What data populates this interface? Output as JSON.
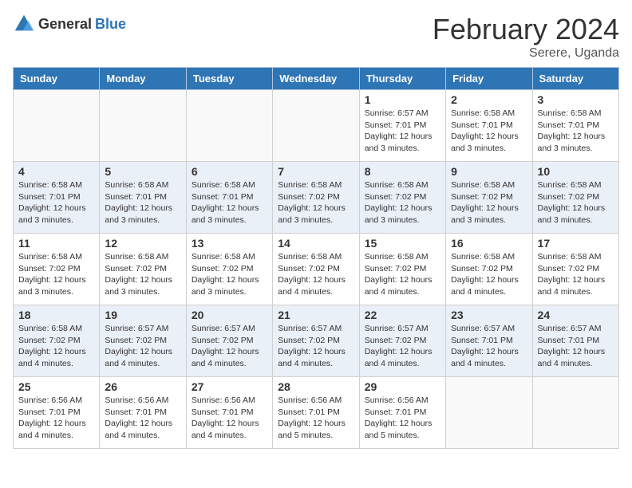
{
  "header": {
    "logo_general": "General",
    "logo_blue": "Blue",
    "month": "February 2024",
    "location": "Serere, Uganda"
  },
  "weekdays": [
    "Sunday",
    "Monday",
    "Tuesday",
    "Wednesday",
    "Thursday",
    "Friday",
    "Saturday"
  ],
  "weeks": [
    {
      "alt": false,
      "days": [
        {
          "num": "",
          "detail": ""
        },
        {
          "num": "",
          "detail": ""
        },
        {
          "num": "",
          "detail": ""
        },
        {
          "num": "",
          "detail": ""
        },
        {
          "num": "1",
          "detail": "Sunrise: 6:57 AM\nSunset: 7:01 PM\nDaylight: 12 hours\nand 3 minutes."
        },
        {
          "num": "2",
          "detail": "Sunrise: 6:58 AM\nSunset: 7:01 PM\nDaylight: 12 hours\nand 3 minutes."
        },
        {
          "num": "3",
          "detail": "Sunrise: 6:58 AM\nSunset: 7:01 PM\nDaylight: 12 hours\nand 3 minutes."
        }
      ]
    },
    {
      "alt": true,
      "days": [
        {
          "num": "4",
          "detail": "Sunrise: 6:58 AM\nSunset: 7:01 PM\nDaylight: 12 hours\nand 3 minutes."
        },
        {
          "num": "5",
          "detail": "Sunrise: 6:58 AM\nSunset: 7:01 PM\nDaylight: 12 hours\nand 3 minutes."
        },
        {
          "num": "6",
          "detail": "Sunrise: 6:58 AM\nSunset: 7:01 PM\nDaylight: 12 hours\nand 3 minutes."
        },
        {
          "num": "7",
          "detail": "Sunrise: 6:58 AM\nSunset: 7:02 PM\nDaylight: 12 hours\nand 3 minutes."
        },
        {
          "num": "8",
          "detail": "Sunrise: 6:58 AM\nSunset: 7:02 PM\nDaylight: 12 hours\nand 3 minutes."
        },
        {
          "num": "9",
          "detail": "Sunrise: 6:58 AM\nSunset: 7:02 PM\nDaylight: 12 hours\nand 3 minutes."
        },
        {
          "num": "10",
          "detail": "Sunrise: 6:58 AM\nSunset: 7:02 PM\nDaylight: 12 hours\nand 3 minutes."
        }
      ]
    },
    {
      "alt": false,
      "days": [
        {
          "num": "11",
          "detail": "Sunrise: 6:58 AM\nSunset: 7:02 PM\nDaylight: 12 hours\nand 3 minutes."
        },
        {
          "num": "12",
          "detail": "Sunrise: 6:58 AM\nSunset: 7:02 PM\nDaylight: 12 hours\nand 3 minutes."
        },
        {
          "num": "13",
          "detail": "Sunrise: 6:58 AM\nSunset: 7:02 PM\nDaylight: 12 hours\nand 3 minutes."
        },
        {
          "num": "14",
          "detail": "Sunrise: 6:58 AM\nSunset: 7:02 PM\nDaylight: 12 hours\nand 4 minutes."
        },
        {
          "num": "15",
          "detail": "Sunrise: 6:58 AM\nSunset: 7:02 PM\nDaylight: 12 hours\nand 4 minutes."
        },
        {
          "num": "16",
          "detail": "Sunrise: 6:58 AM\nSunset: 7:02 PM\nDaylight: 12 hours\nand 4 minutes."
        },
        {
          "num": "17",
          "detail": "Sunrise: 6:58 AM\nSunset: 7:02 PM\nDaylight: 12 hours\nand 4 minutes."
        }
      ]
    },
    {
      "alt": true,
      "days": [
        {
          "num": "18",
          "detail": "Sunrise: 6:58 AM\nSunset: 7:02 PM\nDaylight: 12 hours\nand 4 minutes."
        },
        {
          "num": "19",
          "detail": "Sunrise: 6:57 AM\nSunset: 7:02 PM\nDaylight: 12 hours\nand 4 minutes."
        },
        {
          "num": "20",
          "detail": "Sunrise: 6:57 AM\nSunset: 7:02 PM\nDaylight: 12 hours\nand 4 minutes."
        },
        {
          "num": "21",
          "detail": "Sunrise: 6:57 AM\nSunset: 7:02 PM\nDaylight: 12 hours\nand 4 minutes."
        },
        {
          "num": "22",
          "detail": "Sunrise: 6:57 AM\nSunset: 7:02 PM\nDaylight: 12 hours\nand 4 minutes."
        },
        {
          "num": "23",
          "detail": "Sunrise: 6:57 AM\nSunset: 7:01 PM\nDaylight: 12 hours\nand 4 minutes."
        },
        {
          "num": "24",
          "detail": "Sunrise: 6:57 AM\nSunset: 7:01 PM\nDaylight: 12 hours\nand 4 minutes."
        }
      ]
    },
    {
      "alt": false,
      "days": [
        {
          "num": "25",
          "detail": "Sunrise: 6:56 AM\nSunset: 7:01 PM\nDaylight: 12 hours\nand 4 minutes."
        },
        {
          "num": "26",
          "detail": "Sunrise: 6:56 AM\nSunset: 7:01 PM\nDaylight: 12 hours\nand 4 minutes."
        },
        {
          "num": "27",
          "detail": "Sunrise: 6:56 AM\nSunset: 7:01 PM\nDaylight: 12 hours\nand 4 minutes."
        },
        {
          "num": "28",
          "detail": "Sunrise: 6:56 AM\nSunset: 7:01 PM\nDaylight: 12 hours\nand 5 minutes."
        },
        {
          "num": "29",
          "detail": "Sunrise: 6:56 AM\nSunset: 7:01 PM\nDaylight: 12 hours\nand 5 minutes."
        },
        {
          "num": "",
          "detail": ""
        },
        {
          "num": "",
          "detail": ""
        }
      ]
    }
  ]
}
